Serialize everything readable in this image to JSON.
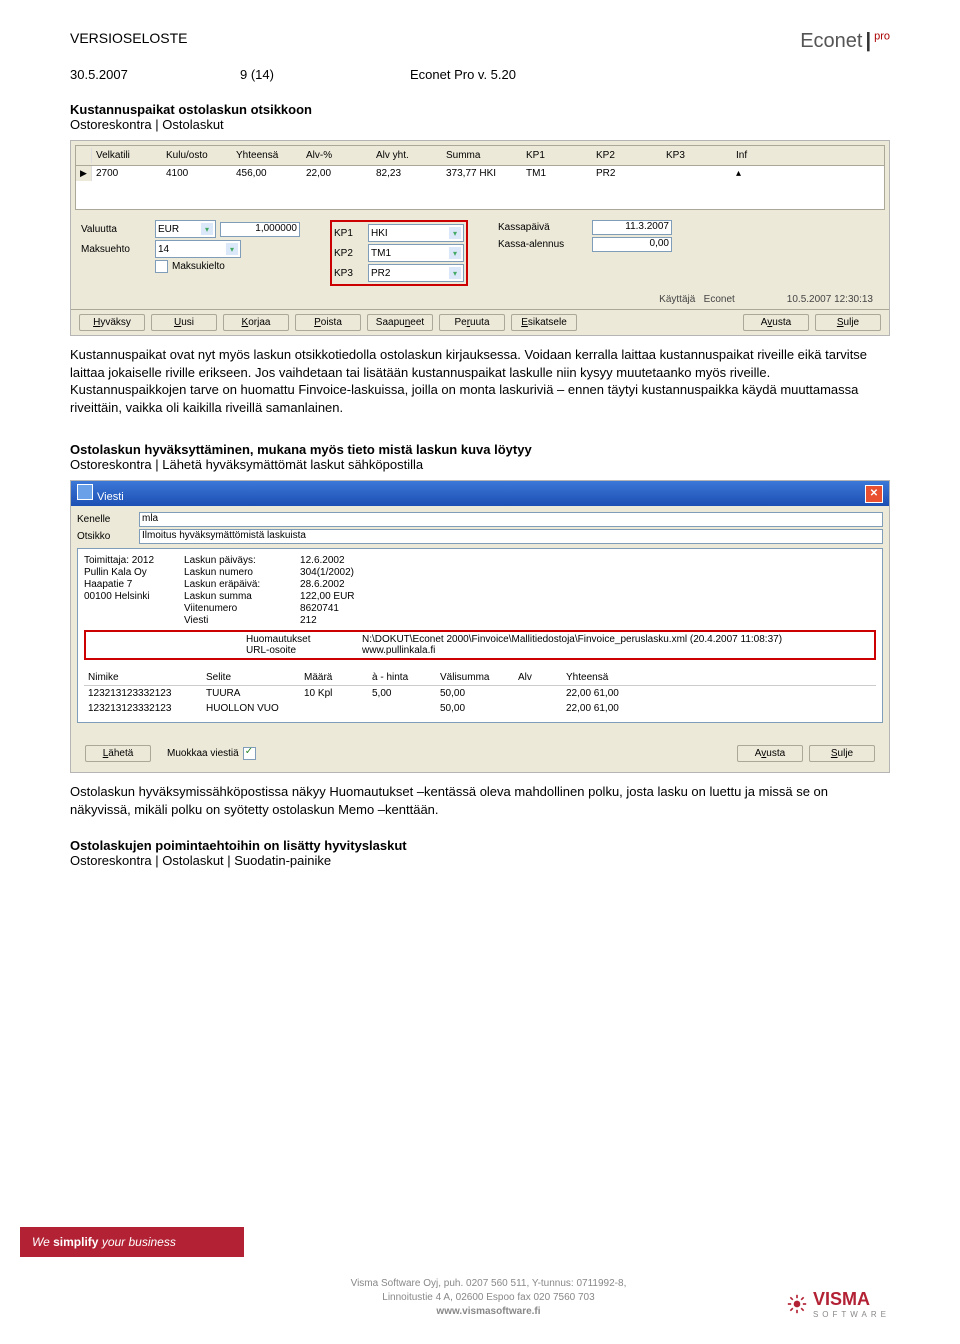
{
  "header": {
    "doc_title": "VERSIOSELOSTE",
    "date": "30.5.2007",
    "page": "9 (14)",
    "product": "Econet Pro v. 5.20",
    "brand": "Econet",
    "brand_suffix": "pro"
  },
  "section1": {
    "title": "Kustannuspaikat ostolaskun otsikkoon",
    "path": "Ostoreskontra | Ostolaskut",
    "grid_headers": [
      "Velkatili",
      "Kulu/osto",
      "Yhteensä",
      "Alv-%",
      "Alv yht.",
      "Summa",
      "KP1",
      "KP2",
      "KP3",
      "Inf"
    ],
    "grid_row": [
      "2700",
      "4100",
      "456,00",
      "22,00",
      "82,23",
      "373,77",
      "HKI",
      "TM1",
      "PR2",
      ""
    ],
    "form": {
      "valuutta_lbl": "Valuutta",
      "valuutta_val": "EUR",
      "kurssi": "1,000000",
      "maksuehto_lbl": "Maksuehto",
      "maksuehto_val": "14",
      "maksukielto_lbl": "Maksukielto",
      "kp1_lbl": "KP1",
      "kp1_val": "HKI",
      "kp2_lbl": "KP2",
      "kp2_val": "TM1",
      "kp3_lbl": "KP3",
      "kp3_val": "PR2",
      "kassapaiva_lbl": "Kassapäivä",
      "kassapaiva_val": "11.3.2007",
      "kassaalennus_lbl": "Kassa-alennus",
      "kassaalennus_val": "0,00"
    },
    "status": {
      "kayttaja_lbl": "Käyttäjä",
      "kayttaja_val": "Econet",
      "ts": "10.5.2007 12:30:13"
    },
    "buttons": [
      "Hyväksy",
      "Uusi",
      "Korjaa",
      "Poista",
      "Saapuneet",
      "Peruuta",
      "Esikatsele",
      "Avusta",
      "Sulje"
    ],
    "para": "Kustannuspaikat ovat nyt myös laskun otsikkotiedolla ostolaskun kirjauksessa. Voidaan kerralla laittaa kustannuspaikat riveille eikä tarvitse laittaa jokaiselle riville erikseen. Jos vaihdetaan tai lisätään kustannuspaikat laskulle niin kysyy muutetaanko myös riveille. Kustannuspaikkojen tarve on huomattu Finvoice-laskuissa, joilla on monta laskuriviä – ennen täytyi kustannuspaikka käydä muuttamassa riveittäin, vaikka oli kaikilla riveillä samanlainen."
  },
  "section2": {
    "title": "Ostolaskun hyväksyttäminen, mukana myös tieto mistä laskun kuva löytyy",
    "path": "Ostoreskontra | Lähetä hyväksymättömät laskut sähköpostilla",
    "win_title": "Viesti",
    "kenelle_lbl": "Kenelle",
    "kenelle_val": "mla",
    "otsikko_lbl": "Otsikko",
    "otsikko_val": "Ilmoitus hyväksymättömistä laskuista",
    "left_col": [
      "Toimittaja: 2012",
      "Pullin Kala Oy",
      "Haapatie 7",
      "00100 Helsinki"
    ],
    "right_col": [
      [
        "Laskun päiväys:",
        "12.6.2002"
      ],
      [
        "Laskun numero",
        "304(1/2002)"
      ],
      [
        "Laskun eräpäivä:",
        "28.6.2002"
      ],
      [
        "Laskun summa",
        "122,00 EUR"
      ],
      [
        "Viitenumero",
        "8620741"
      ],
      [
        "Viesti",
        "212"
      ]
    ],
    "huom_lbl": "Huomautukset",
    "huom_val": "N:\\DOKUT\\Econet 2000\\Finvoice\\Mallitiedostoja\\Finvoice_peruslasku.xml (20.4.2007 11:08:37)",
    "url_lbl": "URL-osoite",
    "url_val": "www.pullinkala.fi",
    "tbl_hdr": [
      "Nimike",
      "Selite",
      "Määrä",
      "à - hinta",
      "Välisumma",
      "Alv",
      "Yhteensä"
    ],
    "tbl_rows": [
      [
        "123213123332123",
        "TUURA",
        "10 Kpl",
        "5,00",
        "50,00",
        "",
        "22,00 61,00"
      ],
      [
        "123213123332123",
        "HUOLLON VUO",
        "",
        "",
        "50,00",
        "",
        "22,00 61,00"
      ]
    ],
    "laheta": "Lähetä",
    "muokkaa": "Muokkaa viestiä",
    "avusta": "Avusta",
    "sulje": "Sulje",
    "para2": "Ostolaskun hyväksymissähköpostissa näkyy Huomautukset –kentässä oleva mahdollinen polku, josta lasku on luettu ja missä se on näkyvissä, mikäli polku on syötetty ostolaskun Memo –kenttään."
  },
  "section3": {
    "title": "Ostolaskujen poimintaehtoihin on lisätty hyvityslaskut",
    "path": "Ostoreskontra | Ostolaskut | Suodatin-painike"
  },
  "footer": {
    "strap1": "We ",
    "strap2": "simplify",
    "strap3": " your business",
    "line1": "Visma Software Oyj, puh. 0207 560 511, Y-tunnus: 0711992-8,",
    "line2": "Linnoitustie 4 A, 02600 Espoo  fax 020 7560 703",
    "line3": "www.vismasoftware.fi",
    "visma": "VISMA",
    "visma_sw": "SOFTWARE"
  }
}
